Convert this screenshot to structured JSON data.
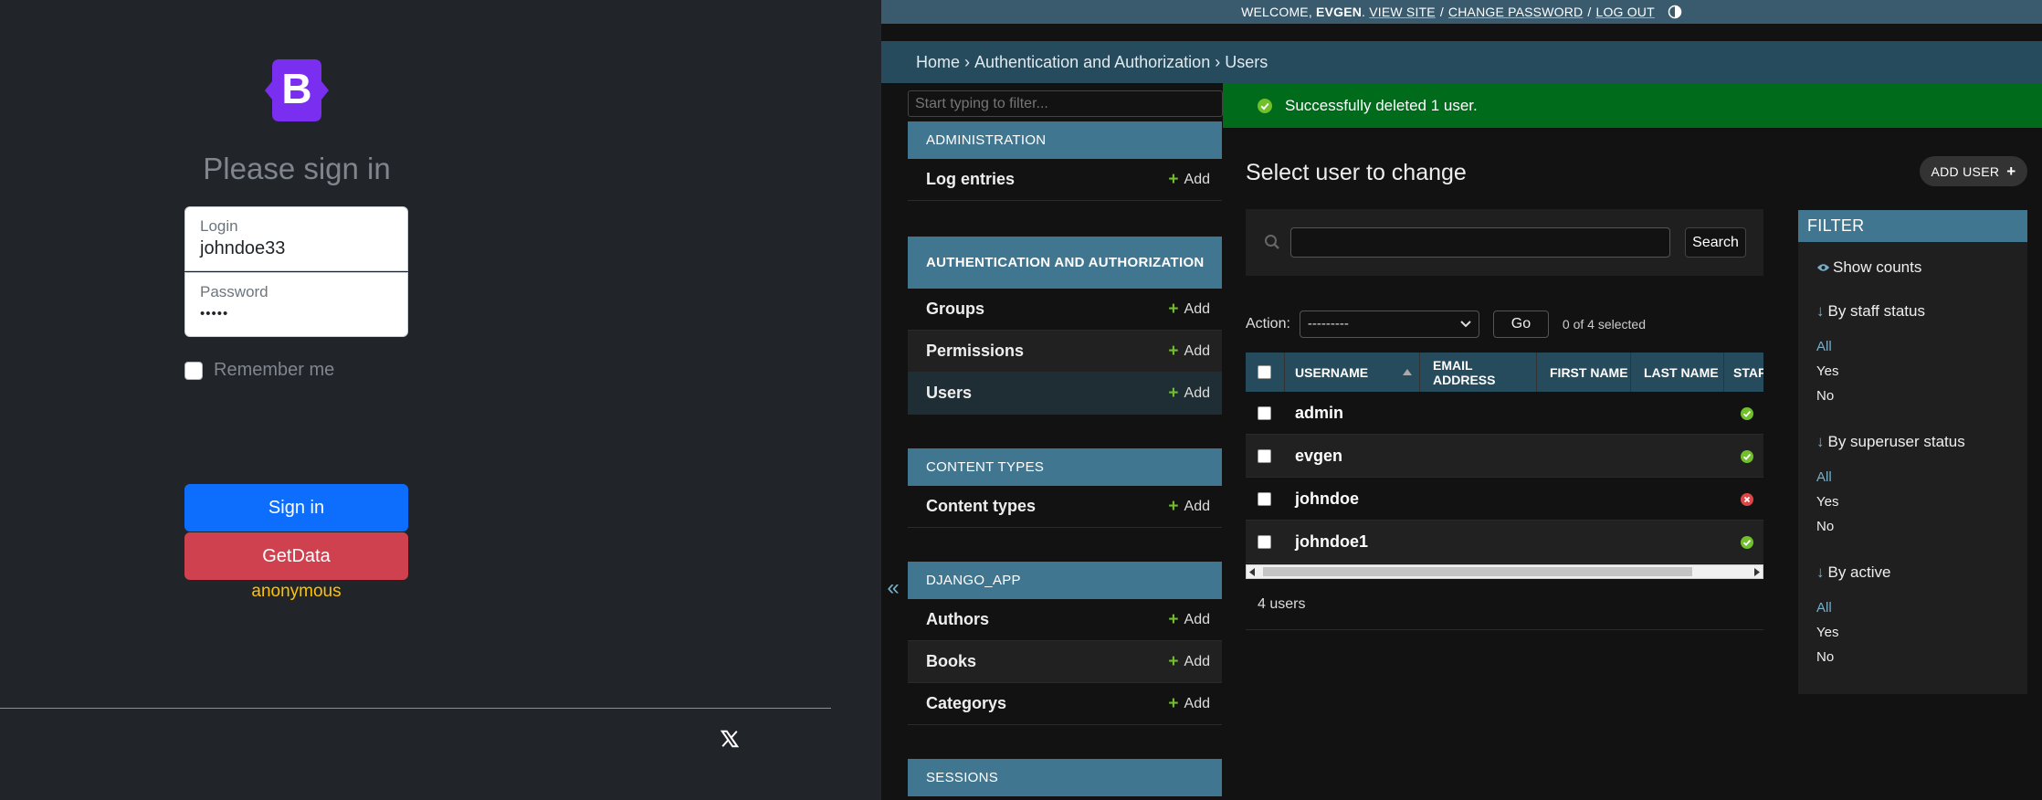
{
  "login": {
    "heading": "Please sign in",
    "login_label": "Login",
    "login_value": "johndoe33",
    "password_label": "Password",
    "password_value": "•••••",
    "remember_label": "Remember me",
    "signin_label": "Sign in",
    "getdata_label": "GetData",
    "user_status": "anonymous",
    "brand_letter": "B"
  },
  "admin": {
    "user_tools": {
      "welcome": "WELCOME,",
      "username": "EVGEN",
      "view_site": "VIEW SITE",
      "change_password": "CHANGE PASSWORD",
      "log_out": "LOG OUT",
      "separator": "/"
    },
    "breadcrumbs": {
      "home": "Home",
      "app": "Authentication and Authorization",
      "current": "Users",
      "separator": " › "
    },
    "nav": {
      "filter_placeholder": "Start typing to filter...",
      "collapse_label": "«",
      "add_label": "Add",
      "modules": {
        "administration": "ADMINISTRATION",
        "auth": "AUTHENTICATION AND AUTHORIZATION",
        "content_types": "CONTENT TYPES",
        "django_app": "DJANGO_APP",
        "sessions": "SESSIONS"
      },
      "models": {
        "log_entries": "Log entries",
        "groups": "Groups",
        "permissions": "Permissions",
        "users": "Users",
        "content_types": "Content types",
        "authors": "Authors",
        "books": "Books",
        "categorys": "Categorys"
      }
    },
    "message": "Successfully deleted 1 user.",
    "title": "Select user to change",
    "add_user": "ADD USER",
    "search_button": "Search",
    "action_label": "Action:",
    "action_value": "---------",
    "go_label": "Go",
    "selected_count": "0 of 4 selected",
    "columns": {
      "username": "USERNAME",
      "email": "EMAIL ADDRESS",
      "first_name": "FIRST NAME",
      "last_name": "LAST NAME",
      "staff": "STAFF"
    },
    "users": [
      {
        "username": "admin",
        "is_staff": true
      },
      {
        "username": "evgen",
        "is_staff": true
      },
      {
        "username": "johndoe",
        "is_staff": false
      },
      {
        "username": "johndoe1",
        "is_staff": true
      }
    ],
    "paginator": "4 users",
    "filter": {
      "title": "FILTER",
      "show_counts": "Show counts",
      "by_staff": "By staff status",
      "by_superuser": "By superuser status",
      "by_active": "By active",
      "all": "All",
      "yes": "Yes",
      "no": "No",
      "arrow": "↓"
    }
  },
  "colors": {
    "accent": "#417690",
    "success": "#006b1b",
    "signin": "#0d6efd",
    "getdata": "#d0414f",
    "brand": "#7952b3"
  }
}
